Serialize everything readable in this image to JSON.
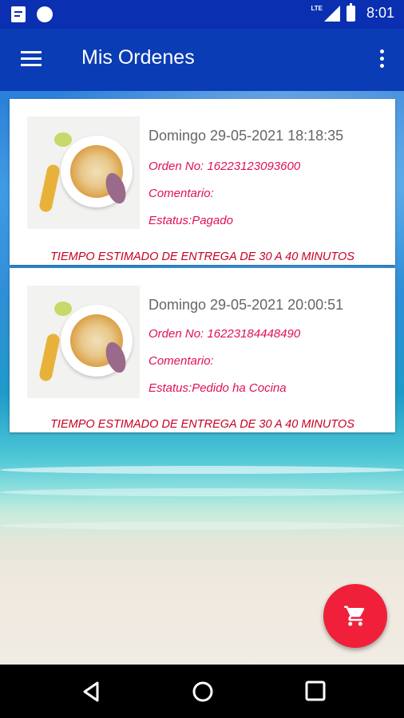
{
  "status_bar": {
    "time": "8:01",
    "network_label": "LTE",
    "icons": [
      "document-icon",
      "circle-icon",
      "signal-icon",
      "battery-icon"
    ]
  },
  "app_bar": {
    "title": "Mis Ordenes",
    "menu_icon": "menu-icon",
    "overflow_icon": "more-vert-icon"
  },
  "orders": [
    {
      "date": "Domingo 29-05-2021 18:18:35",
      "order_no": "Orden No: 16223123093600",
      "comment": "Comentario:",
      "status": "Estatus:Pagado",
      "eta": "TIEMPO ESTIMADO DE ENTREGA DE 30 A 40 MINUTOS"
    },
    {
      "date": "Domingo 29-05-2021 20:00:51",
      "order_no": "Orden No: 16223184448490",
      "comment": "Comentario:",
      "status": "Estatus:Pedido ha Cocina",
      "eta": "TIEMPO ESTIMADO DE ENTREGA DE 30 A 40 MINUTOS"
    }
  ],
  "fab": {
    "icon": "cart-icon",
    "color": "#f0203a"
  },
  "nav": {
    "icons": [
      "back-icon",
      "home-icon",
      "recents-icon"
    ]
  },
  "colors": {
    "app_bar": "#0a3cb5",
    "status_bar": "#0a2fb0",
    "order_text": "#e0105a",
    "eta_text": "#c80020"
  }
}
